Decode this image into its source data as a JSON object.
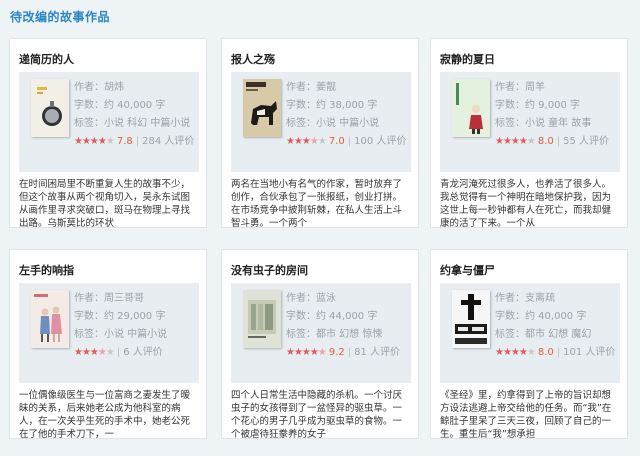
{
  "section_title": "待改编的故事作品",
  "cards": [
    {
      "title": "递简历的人",
      "author": "作者：胡炜",
      "words": "字数：约 40,000 字",
      "tags": "标签：小说 科幻 中篇小说",
      "score": "7.8",
      "reviews": "284 人评价",
      "stars_filled": 4,
      "desc": "在时间困局里不断重复人生的故事不少，但这个故事从两个视角切入，吴永东试图从画作里寻求突破口，斑马在物理上寻找出路。乌斯莫比的环状",
      "cover_icon": "lightbulb-cover-icon"
    },
    {
      "title": "报人之殇",
      "author": "作者：姜靓",
      "words": "字数：约 38,000 字",
      "tags": "标签：小说 中篇小说",
      "score": "7.0",
      "reviews": "100 人评价",
      "stars_filled": 3.5,
      "desc": "两名在当地小有名气的作家，暂时放弃了创作，合伙承包了一张报纸，创业打拼。在市场竞争中披荆斩棘，在私人生活上斗智斗勇。一个两个",
      "cover_icon": "dog-cover-icon"
    },
    {
      "title": "寂静的夏日",
      "author": "作者：周羊",
      "words": "字数：约 9,000 字",
      "tags": "标签：小说 童年 故事",
      "score": "8.0",
      "reviews": "55 人评价",
      "stars_filled": 4,
      "desc": "青龙河淹死过很多人，也养活了很多人。我总觉得有一个神明在暗地保护我，因为这世上每一秒钟都有人在死亡，而我却健康的活了下来。一个从",
      "cover_icon": "child-cover-icon"
    },
    {
      "title": "左手的响指",
      "author": "作者：周三哥哥",
      "words": "字数：约 29,000 字",
      "tags": "标签：小说 中篇小说",
      "score": "",
      "reviews": "6 人评价",
      "stars_filled": 3.5,
      "desc": "一位偶像级医生与一位富商之妻发生了暧昧的关系，后来她老公成为他科室的病人，在一次关乎生死的手术中，她老公死在了他的手术刀下，一",
      "cover_icon": "couple-cover-icon"
    },
    {
      "title": "没有虫子的房间",
      "author": "作者：蓝泳",
      "words": "字数：约 44,000 字",
      "tags": "标签：都市 幻想 惊悚",
      "score": "9.2",
      "reviews": "81 人评价",
      "stars_filled": 4.5,
      "desc": "四个人日常生活中隐藏的杀机。一个讨厌虫子的女孩得到了一盆怪异的驱虫草。一个花心的男子几乎成为驱虫草的食物。一个被虐待狂豢养的女子",
      "cover_icon": "room-cover-icon"
    },
    {
      "title": "约拿与僵尸",
      "author": "作者：支离疏",
      "words": "字数：约 40,000 字",
      "tags": "标签：都市 幻想 魔幻",
      "score": "8.0",
      "reviews": "101 人评价",
      "stars_filled": 4,
      "desc": "《圣经》里，约拿得到了上帝的旨识却想方设法逃避上帝交给他的任务。而“我”在鲸肚子里呆了三天三夜，回顾了自己的一生。重生后“我”想承担",
      "cover_icon": "cross-cover-icon"
    }
  ]
}
